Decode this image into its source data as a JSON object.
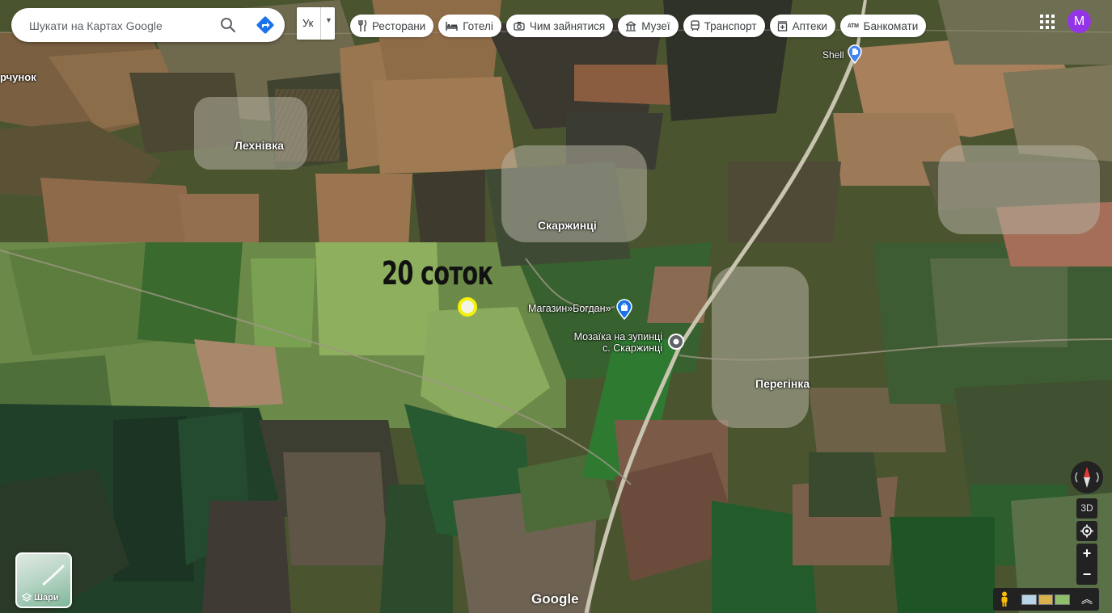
{
  "search": {
    "placeholder": "Шукати на Картах Google"
  },
  "input_method": {
    "label": "Ук"
  },
  "categories": [
    {
      "label": "Ресторани",
      "icon": "restaurant-icon"
    },
    {
      "label": "Готелі",
      "icon": "hotel-icon"
    },
    {
      "label": "Чим зайнятися",
      "icon": "camera-icon"
    },
    {
      "label": "Музеї",
      "icon": "museum-icon"
    },
    {
      "label": "Транспорт",
      "icon": "transit-icon"
    },
    {
      "label": "Аптеки",
      "icon": "pharmacy-icon"
    },
    {
      "label": "Банкомати",
      "icon": "atm-icon"
    }
  ],
  "account": {
    "initial": "M",
    "color": "#9334e6"
  },
  "map_labels": {
    "partial_village": "рчунок",
    "village_1": "Лехнівка",
    "village_2": "Скаржинці",
    "village_3": "Перегінка",
    "poi_gas": "Shell",
    "poi_shop": "Магазин»Богдан»",
    "poi_mosaic_line1": "Мозаїка на зупинці",
    "poi_mosaic_line2": "с. Скаржинці"
  },
  "annotation": {
    "text": "20 соток",
    "marker_color": "#f5f007"
  },
  "layers": {
    "label": "Шари"
  },
  "controls": {
    "three_d": "3D",
    "zoom_in": "+",
    "zoom_out": "−"
  },
  "attribution": "Google"
}
